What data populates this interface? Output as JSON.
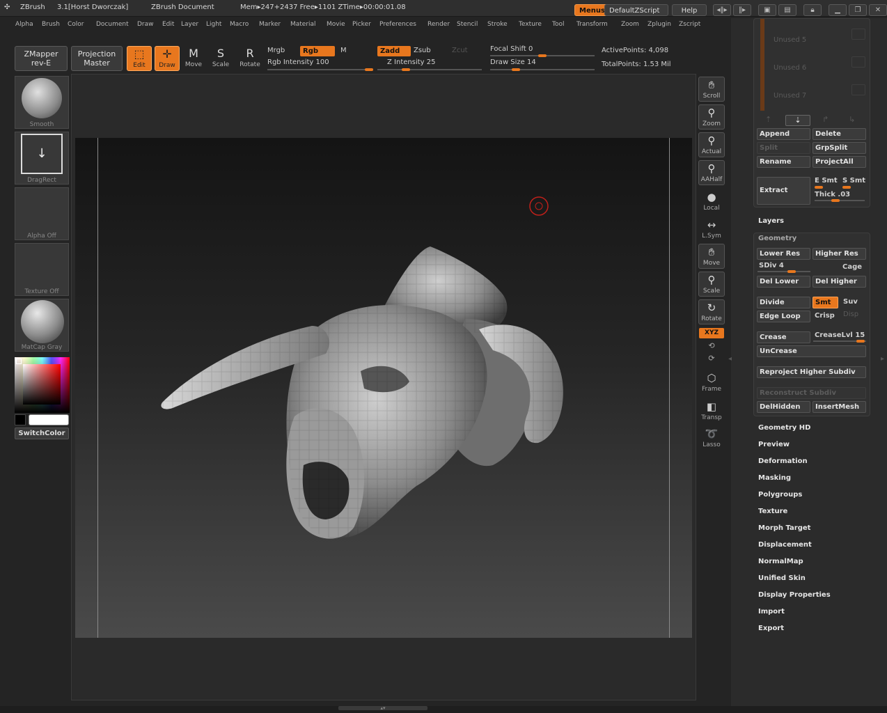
{
  "titlebar": {
    "app": "ZBrush",
    "version": "3.1[Horst Dworczak]",
    "doc": "ZBrush Document",
    "mem": "Mem▸247+2437  Free▸1101  ZTime▸00:00:01.08",
    "menus_label": "Menus",
    "script_label": "DefaultZScript",
    "help_label": "Help"
  },
  "menubar": [
    "Alpha",
    "Brush",
    "Color",
    "Document",
    "Draw",
    "Edit",
    "Layer",
    "Light",
    "Macro",
    "Marker",
    "Material",
    "Movie",
    "Picker",
    "Preferences",
    "Render",
    "Stencil",
    "Stroke",
    "Texture",
    "Tool",
    "Transform",
    "Zoom",
    "Zplugin",
    "Zscript"
  ],
  "toolbar": {
    "zmapper_l1": "ZMapper",
    "zmapper_l2": "rev-E",
    "proj_l1": "Projection",
    "proj_l2": "Master",
    "edit": "Edit",
    "draw": "Draw",
    "move": "Move",
    "scale": "Scale",
    "rotate": "Rotate",
    "mrgb": "Mrgb",
    "rgb": "Rgb",
    "m": "M",
    "zadd": "Zadd",
    "zsub": "Zsub",
    "zcut": "Zcut",
    "rgb_intensity": "Rgb Intensity 100",
    "z_intensity": "Z Intensity 25",
    "focal_shift": "Focal Shift 0",
    "draw_size": "Draw Size 14",
    "active_points": "ActivePoints: 4,098",
    "total_points": "TotalPoints: 1.53 Mil",
    "rgb_intensity_value": 100,
    "z_intensity_value": 25,
    "focal_shift_value": 0,
    "draw_size_value": 14
  },
  "left_shelf": {
    "brush": "Smooth",
    "stroke": "DragRect",
    "alpha": "Alpha Off",
    "texture": "Texture Off",
    "material": "MatCap Gray",
    "switch_color": "SwitchColor"
  },
  "right_shelf": [
    "Scroll",
    "Zoom",
    "Actual",
    "AAHalf",
    "Local",
    "L.Sym",
    "Move",
    "Scale",
    "Rotate",
    "XYZ",
    "Frame",
    "Transp",
    "Lasso"
  ],
  "subtool": {
    "unused": [
      "Unused 5",
      "Unused 6",
      "Unused 7"
    ],
    "append": "Append",
    "delete": "Delete",
    "split": "Split",
    "grpsplit": "GrpSplit",
    "rename": "Rename",
    "projectall": "ProjectAll",
    "extract": "Extract",
    "e_smt": "E Smt",
    "s_smt": "S Smt",
    "thick": "Thick .03"
  },
  "layers_label": "Layers",
  "geometry": {
    "title": "Geometry",
    "lower_res": "Lower Res",
    "higher_res": "Higher Res",
    "sdiv": "SDiv 4",
    "cage": "Cage",
    "del_lower": "Del Lower",
    "del_higher": "Del Higher",
    "divide": "Divide",
    "smt": "Smt",
    "suv": "Suv",
    "edge_loop": "Edge Loop",
    "crisp": "Crisp",
    "disp": "Disp",
    "crease": "Crease",
    "crease_lvl": "CreaseLvl 15",
    "uncrease": "UnCrease",
    "reproject": "Reproject Higher Subdiv",
    "reconstruct": "Reconstruct Subdiv",
    "delhidden": "DelHidden",
    "insertmesh": "InsertMesh"
  },
  "tool_sections": [
    "Geometry HD",
    "Preview",
    "Deformation",
    "Masking",
    "Polygroups",
    "Texture",
    "Morph Target",
    "Displacement",
    "NormalMap",
    "Unified Skin",
    "Display Properties",
    "Import",
    "Export"
  ],
  "colors": {
    "accent": "#e8771e",
    "panel": "#303030",
    "background": "#242424"
  }
}
